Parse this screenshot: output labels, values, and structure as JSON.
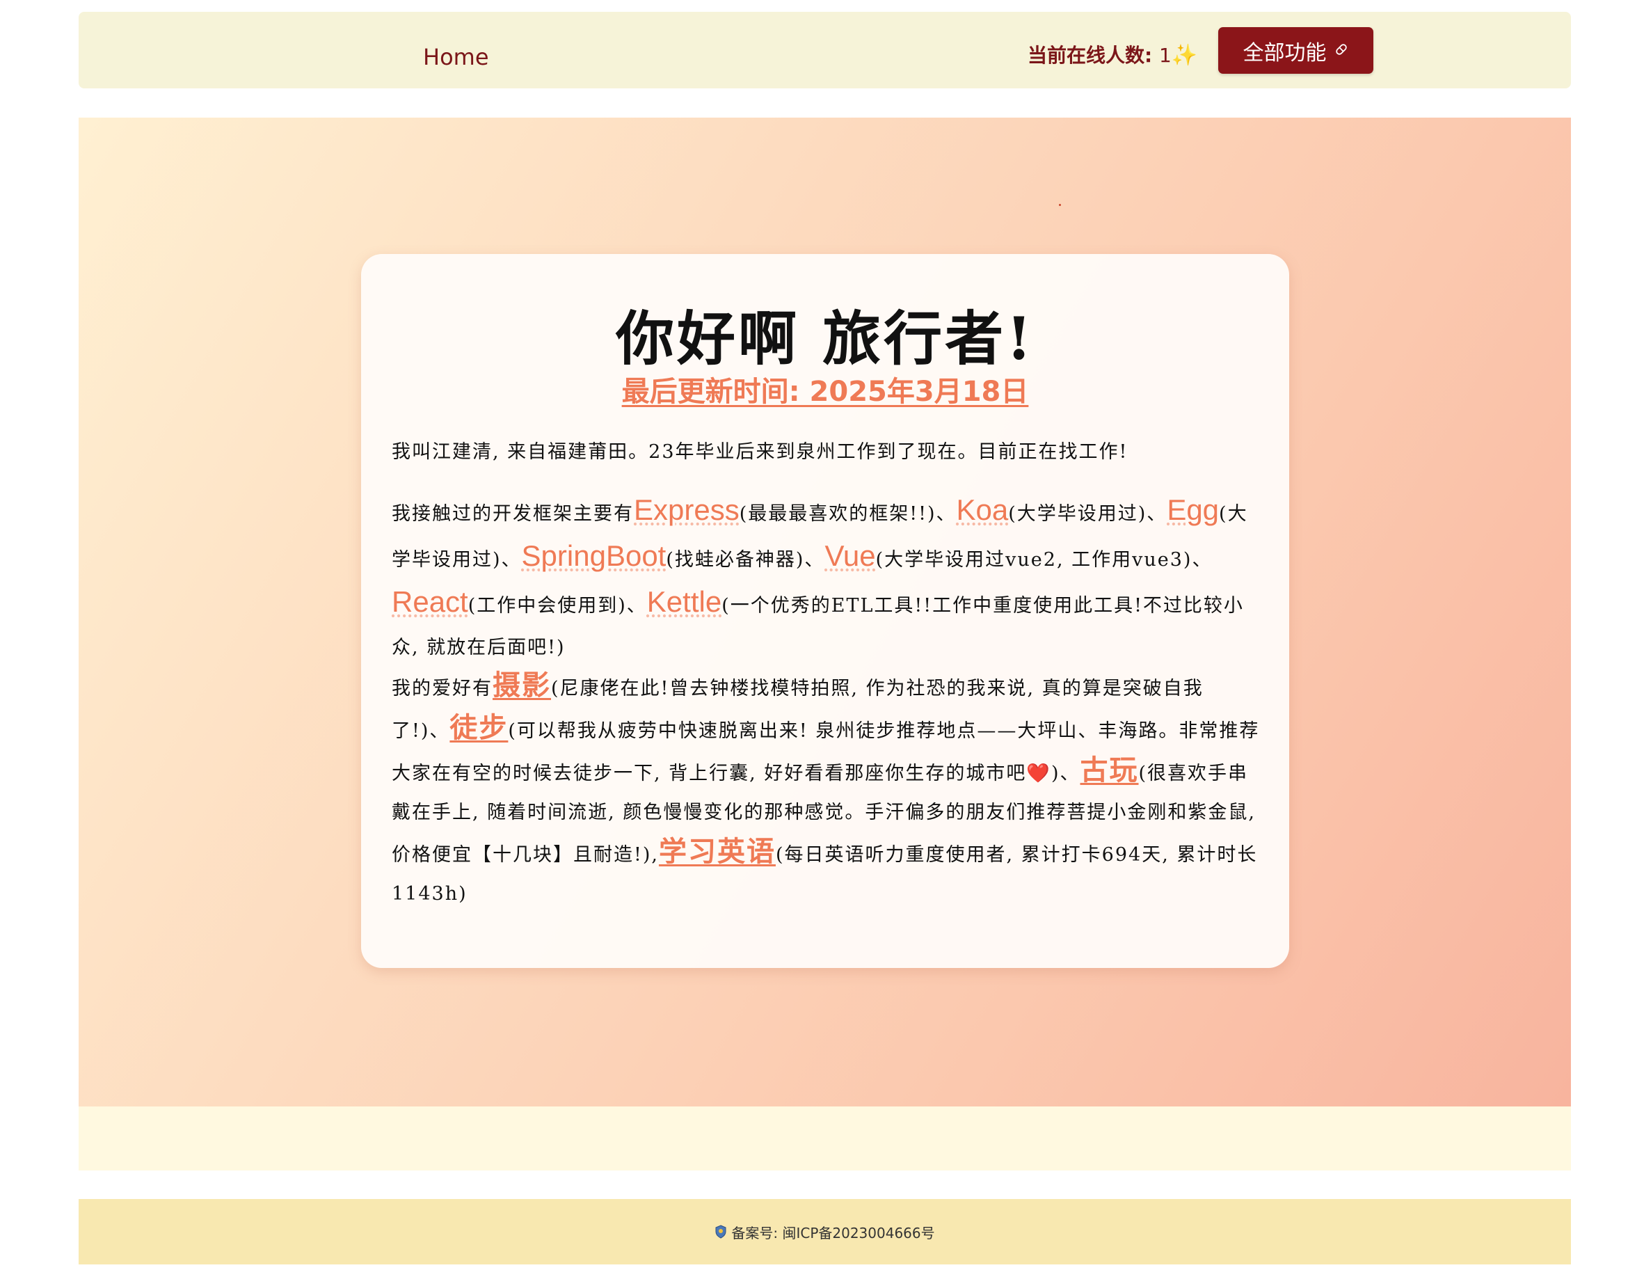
{
  "navbar": {
    "home_label": "Home",
    "online_label": "当前在线人数:",
    "online_count": "1",
    "sparkle": "✨",
    "all_features_label": "全部功能",
    "all_features_icon": "pill-icon"
  },
  "card": {
    "title": "你好啊 旅行者!",
    "updated": "最后更新时间: 2025年3月18日",
    "intro": "我叫江建清, 来自福建莆田。23年毕业后来到泉州工作到了现在。目前正在找工作!",
    "frameworks": {
      "lead": "我接触过的开发框架主要有",
      "items": [
        {
          "name": "Express",
          "note": "(最最最喜欢的框架!!)、"
        },
        {
          "name": "Koa",
          "note": "(大学毕设用过)、"
        },
        {
          "name": "Egg",
          "note": "(大学毕设用过)、"
        },
        {
          "name": "SpringBoot",
          "note": "(找蛙必备神器)、"
        },
        {
          "name": "Vue",
          "note": "(大学毕设用过vue2, 工作用vue3)、"
        },
        {
          "name": "React",
          "note": "(工作中会使用到)、"
        },
        {
          "name": "Kettle",
          "note": "(一个优秀的ETL工具!!工作中重度使用此工具!不过比较小众, 就放在后面吧!)"
        }
      ]
    },
    "hobbies": {
      "lead": "我的爱好有",
      "items": [
        {
          "name": "摄影",
          "note": "(尼康佬在此!曾去钟楼找模特拍照, 作为社恐的我来说, 真的算是突破自我了!)、"
        },
        {
          "name": "徒步",
          "note_a": "(可以帮我从疲劳中快速脱离出来! 泉州徒步推荐地点——大坪山、丰海路。非常推荐大家在有空的时候去徒步一下, 背上行囊, 好好看看那座你生存的城市吧",
          "heart": "❤️",
          "note_b": ")、"
        },
        {
          "name": "古玩",
          "note": "(很喜欢手串戴在手上, 随着时间流逝, 颜色慢慢变化的那种感觉。手汗偏多的朋友们推荐菩提小金刚和紫金鼠, 价格便宜【十几块】且耐造!),"
        },
        {
          "name": "学习英语",
          "note": "(每日英语听力重度使用者, 累计打卡694天, 累计时长1143h)"
        }
      ]
    }
  },
  "footer": {
    "beian_icon": "police-badge-icon",
    "beian_text": "备案号: 闽ICP备2023004666号"
  },
  "colors": {
    "brand": "#8b1519",
    "accent": "#ef7a55",
    "navbar_bg": "#f6f3d8",
    "footer_bg": "#f8e8b0"
  }
}
